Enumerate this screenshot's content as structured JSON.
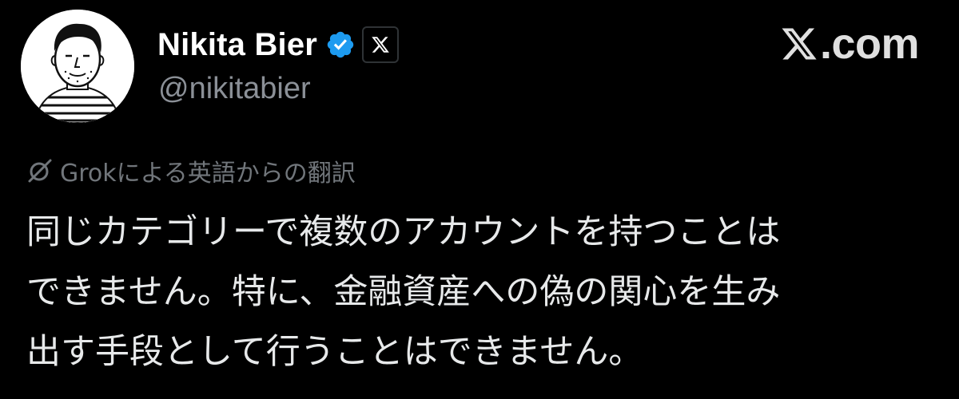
{
  "author": {
    "display_name": "Nikita Bier",
    "handle": "@nikitabier",
    "verified_icon": "verified-badge-icon",
    "affiliation_icon": "x-logo-icon"
  },
  "brand": {
    "icon": "x-logo-icon",
    "text": ".com"
  },
  "translation": {
    "icon": "grok-icon",
    "label": "Grokによる英語からの翻訳"
  },
  "tweet": {
    "lines": [
      "同じカテゴリーで複数のアカウントを持つことは",
      "できません。特に、金融資産への偽の関心を生み",
      "出す手段として行うことはできません。"
    ]
  },
  "colors": {
    "background": "#000000",
    "verified_blue": "#1d9bf0",
    "muted_text": "#71767b"
  }
}
